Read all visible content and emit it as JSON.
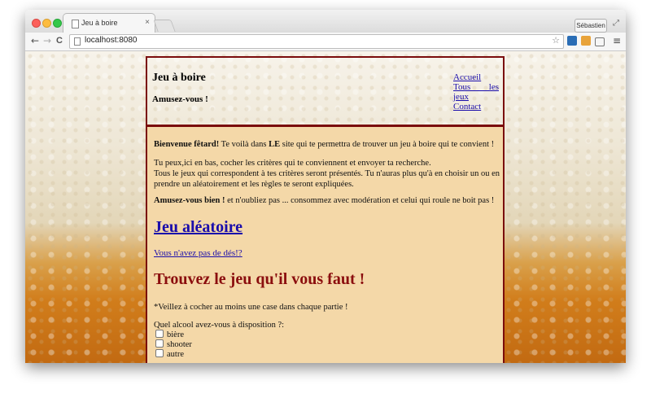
{
  "browser": {
    "tab_title": "Jeu à boire",
    "tab_close": "×",
    "user_button": "Sébastien",
    "url": "localhost:8080",
    "nav": {
      "back": "←",
      "forward": "→",
      "reload": "C"
    }
  },
  "site": {
    "title": "Jeu à boire",
    "tagline": "Amusez-vous !",
    "menu": [
      {
        "label": "Accueil"
      },
      {
        "label": "Tous les jeux"
      },
      {
        "label": "Contact"
      }
    ]
  },
  "main": {
    "intro_bold": "Bienvenue fêtard!",
    "intro_rest_1": " Te voilà dans ",
    "intro_le": "LE",
    "intro_rest_2": " site qui te permettra de trouver un jeu à boire qui te convient !",
    "para2_line1": "Tu peux,ici en bas, cocher les critères qui te conviennent et envoyer ta recherche.",
    "para2_line2": "Tous le jeux qui correspondent à tes critères seront présentés. Tu n'auras plus qu'à en choisir un ou en",
    "para2_line3": "prendre un aléatoirement et les règles te seront expliquées.",
    "para3_bold": "Amusez-vous bien !",
    "para3_rest": " et n'oubliez pas ... consommez avec modération et celui qui roule ne boit pas !",
    "random_link": "Jeu aléatoire",
    "no_dice_link": "Vous n'avez pas de dés!?",
    "finder_title": "Trouvez le jeu qu'il vous faut !",
    "note_star": "*",
    "note": "Veillez à cocher au moins une case dans chaque partie !",
    "question": "Quel alcool avez-vous à disposition ?:",
    "options": [
      "bière",
      "shooter",
      "autre"
    ]
  }
}
